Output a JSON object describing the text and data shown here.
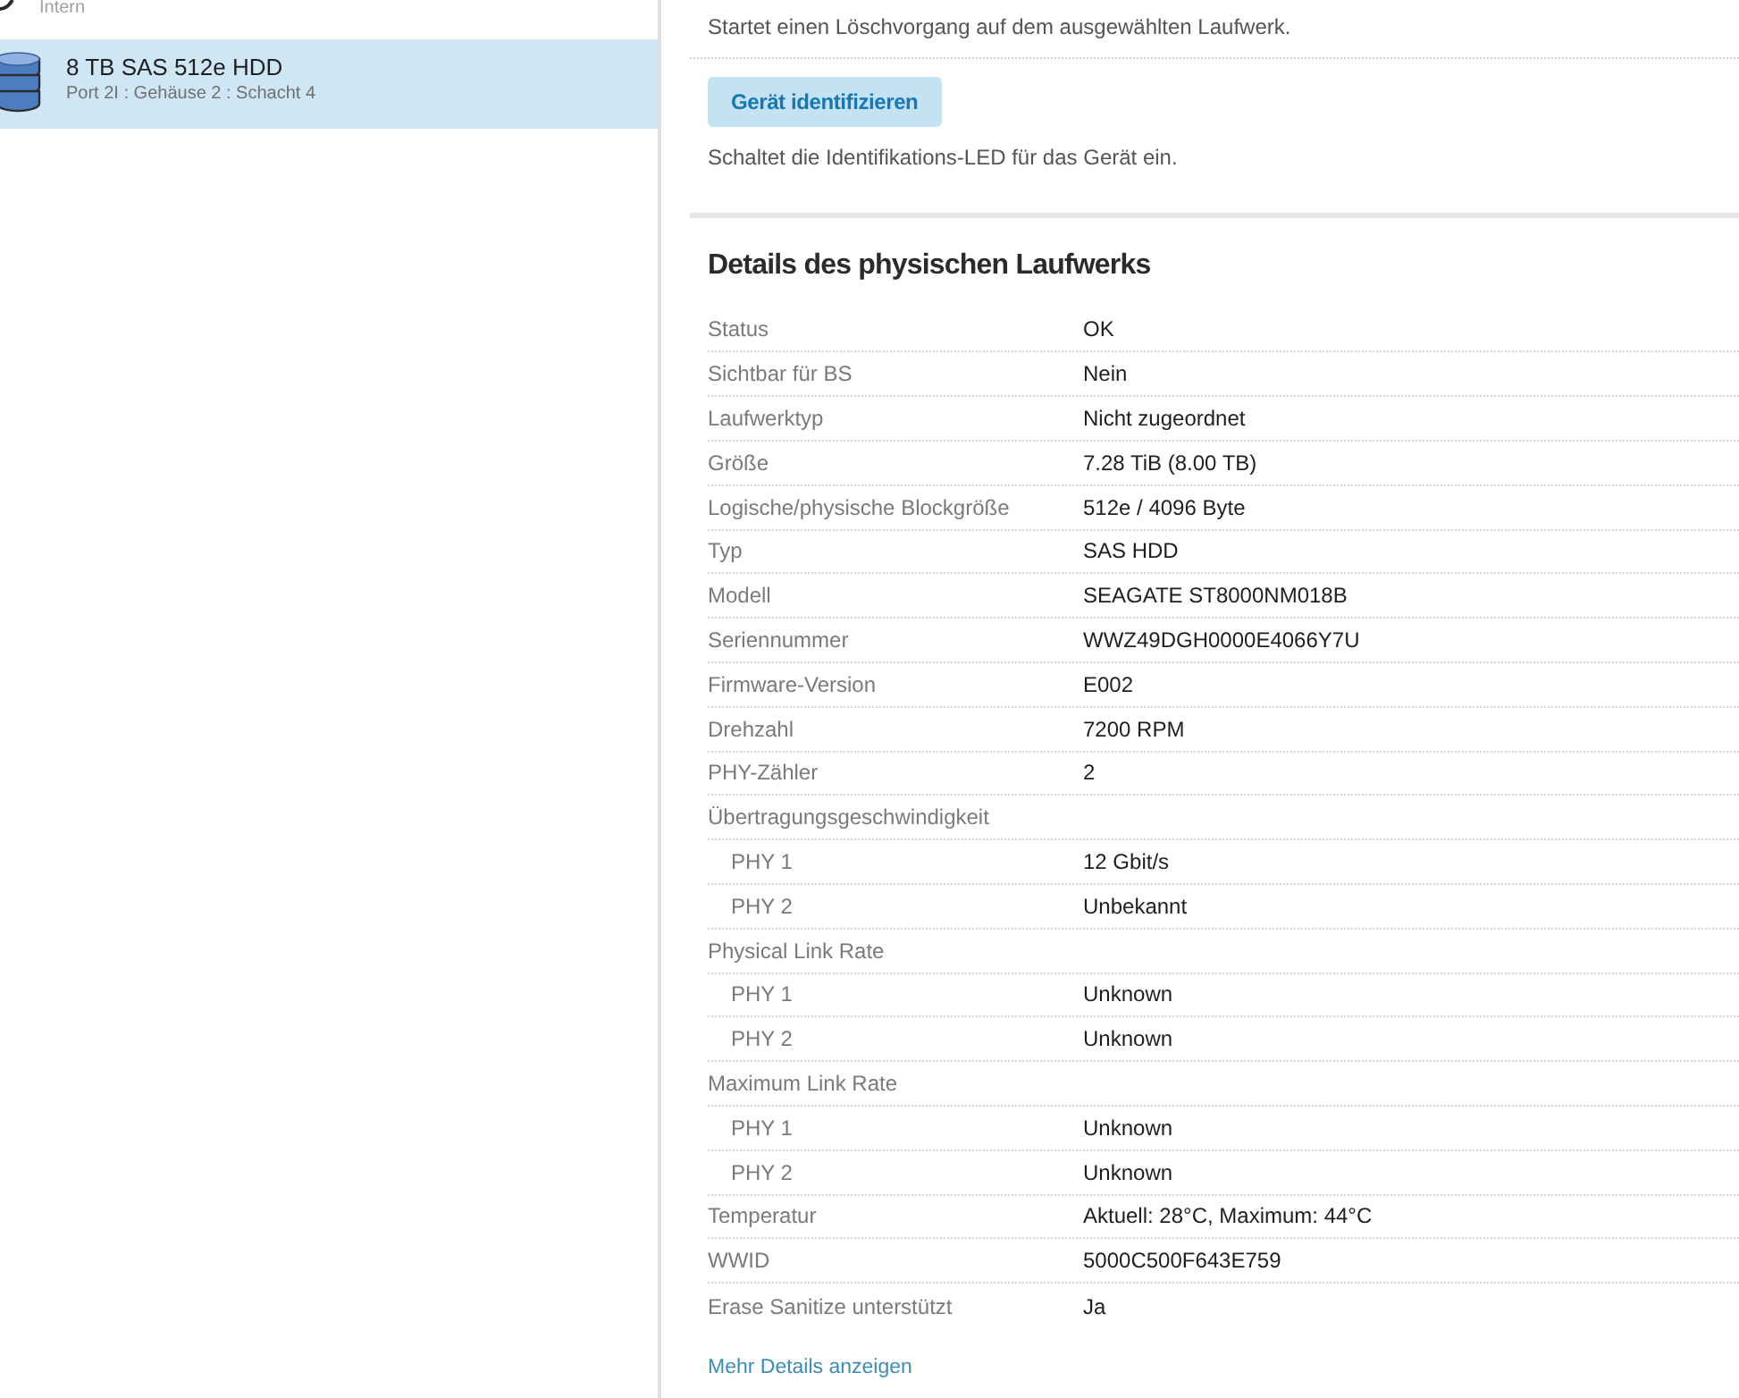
{
  "sidebar": {
    "group_label": "Intern",
    "items": [
      {
        "title": "8 TB SAS 512e HDD",
        "subtitle": "Port 2I : Gehäuse 2 : Schacht 4",
        "selected": true
      }
    ]
  },
  "action_blocks": [
    {
      "description": "Startet einen Löschvorgang auf dem ausgewählten Laufwerk."
    },
    {
      "button": "Gerät identifizieren",
      "description": "Schaltet die Identifikations-LED für das Gerät ein."
    }
  ],
  "details": {
    "title": "Details des physischen Laufwerks",
    "rows": [
      {
        "label": "Status",
        "value": "OK"
      },
      {
        "label": "Sichtbar für BS",
        "value": "Nein"
      },
      {
        "label": "Laufwerktyp",
        "value": "Nicht zugeordnet"
      },
      {
        "label": "Größe",
        "value": "7.28 TiB (8.00 TB)"
      },
      {
        "label": "Logische/physische Blockgröße",
        "value": "512e / 4096 Byte"
      },
      {
        "label": "Typ",
        "value": "SAS HDD"
      },
      {
        "label": "Modell",
        "value": "SEAGATE ST8000NM018B"
      },
      {
        "label": "Seriennummer",
        "value": "WWZ49DGH0000E4066Y7U"
      },
      {
        "label": "Firmware-Version",
        "value": "E002"
      },
      {
        "label": "Drehzahl",
        "value": "7200 RPM"
      },
      {
        "label": "PHY-Zähler",
        "value": "2"
      },
      {
        "label": "Übertragungsgeschwindigkeit",
        "children": [
          {
            "label": "PHY 1",
            "value": "12 Gbit/s"
          },
          {
            "label": "PHY 2",
            "value": "Unbekannt"
          }
        ]
      },
      {
        "label": "Physical Link Rate",
        "children": [
          {
            "label": "PHY 1",
            "value": "Unknown"
          },
          {
            "label": "PHY 2",
            "value": "Unknown"
          }
        ]
      },
      {
        "label": "Maximum Link Rate",
        "children": [
          {
            "label": "PHY 1",
            "value": "Unknown"
          },
          {
            "label": "PHY 2",
            "value": "Unknown"
          }
        ]
      },
      {
        "label": "Temperatur",
        "value": "Aktuell: 28°C, Maximum: 44°C"
      },
      {
        "label": "WWID",
        "value": "5000C500F643E759"
      },
      {
        "label": "Erase Sanitize unterstützt",
        "value": "Ja"
      }
    ],
    "more_link": "Mehr Details anzeigen"
  }
}
